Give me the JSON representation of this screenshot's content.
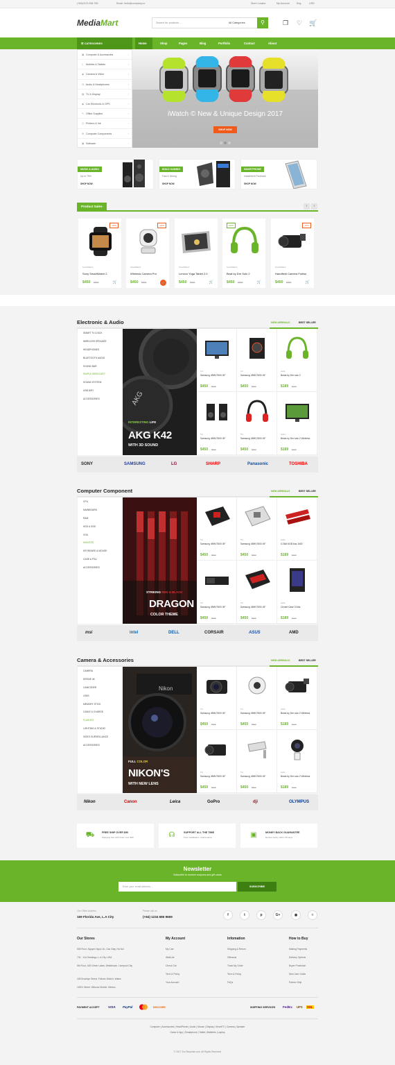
{
  "topbar": {
    "phone": "(+84)0123 456 789",
    "email": "Email: hello@company.co",
    "store_locator": "Store Locator",
    "my_account": "My Account",
    "language": "Eng",
    "currency": "USD"
  },
  "header": {
    "logo_main": "Media",
    "logo_accent": "Mart",
    "search_placeholder": "Search for products ...",
    "search_category": "All Categories"
  },
  "nav": {
    "categories_label": "CATEGORIES",
    "items": [
      "Home",
      "Shop",
      "Pages",
      "Blog",
      "Portfolio",
      "Contact",
      "About"
    ]
  },
  "categories": [
    "Computer & Accessories",
    "Mobiles & Tablets",
    "Camera & Video",
    "Audio & Headphones",
    "TV & Display",
    "Car Electronic & GPS",
    "Office Supplies",
    "Printers & Ink",
    "Computer Components",
    "Software"
  ],
  "hero": {
    "title": "iWatch © New & Unique Design 2017",
    "cta": "SHOP NOW"
  },
  "banners": [
    {
      "tag": "MUSIC & AUDIO",
      "sub": "Up to 75%",
      "link": "SHOP NOW"
    },
    {
      "tag": "BUILD GAMING",
      "sub": "Fast & Strong",
      "link": "SHOP NOW"
    },
    {
      "tag": "SMARTPHONE",
      "sub": "Installment Purchase",
      "link": "SHOP NOW"
    }
  ],
  "product_sales": {
    "title": "Product Sales",
    "items": [
      {
        "brand": "SmartWatch",
        "name": "Sony SmartWatch 2",
        "price": "$450",
        "old": "$500",
        "badge": "-20%"
      },
      {
        "brand": "SmartWatch",
        "name": "Wireless Camera Pro",
        "price": "$450",
        "old": "$500",
        "badge": "-20%"
      },
      {
        "brand": "SmartWatch",
        "name": "Lenovo Yoga Tablet 2.0",
        "price": "$450",
        "old": "$500",
        "badge": ""
      },
      {
        "brand": "SmartWatch",
        "name": "Beat by Dre Solo 2",
        "price": "$450",
        "old": "$500",
        "badge": "NEW"
      },
      {
        "brand": "SmartWatch",
        "name": "Handfield Camera Forliss",
        "price": "$450",
        "old": "$500",
        "badge": "-20%"
      }
    ]
  },
  "tabs": {
    "new": "NEW ARRIVALS",
    "best": "BEST SELLER"
  },
  "sections": [
    {
      "title": "Electronic & Audio",
      "list": [
        "SMART TV & BOX",
        "WIRELESS SPEAKER",
        "HEADPHONES",
        "BLUETOOTH AUDIO",
        "SOUND BAR",
        "SIMPLE WEEKCARY",
        "SOUND SYSTEM",
        "USB WIFI",
        "ACCESSORIES"
      ],
      "promo": {
        "l1a": "INTERESTING",
        "l1b": " LIFE",
        "l2": "AKG K42",
        "l3": "WITH 3D SOUND"
      },
      "products": [
        {
          "brand": "Tivi",
          "name": "Samsung 49MV7600 49\"",
          "price": "$450",
          "old": "$500"
        },
        {
          "brand": "Tivi",
          "name": "Samsung 49MV7600 49\"",
          "price": "$450",
          "old": "$500"
        },
        {
          "brand": "Audio",
          "name": "Beats by Dre solo 2",
          "price": "$189",
          "old": "$220"
        },
        {
          "brand": "Tivi",
          "name": "Samsung 49MV7600 49\"",
          "price": "$450",
          "old": "$500"
        },
        {
          "brand": "Tivi",
          "name": "Samsung 49MV7600 49\"",
          "price": "$450",
          "old": "$500"
        },
        {
          "brand": "Audio",
          "name": "Beats by Dre solo 2 Wireless",
          "price": "$189",
          "old": "$220"
        }
      ],
      "brands": [
        "SONY",
        "SAMSUNG",
        "LG",
        "SHARP",
        "Panasonic",
        "TOSHIBA"
      ]
    },
    {
      "title": "Computer Component",
      "list": [
        "CPU",
        "MAINBOARD",
        "RAM",
        "HDD & SSD",
        "VGA",
        "MONITER",
        "KEYBOARD & MOUSE",
        "CASE & PSU",
        "ACCESSORIES"
      ],
      "promo": {
        "l1a": "STRIKING",
        "l1b": " RED & BLACK",
        "l2": "DRAGON",
        "l3": "COLOR THEME"
      },
      "products": [
        {
          "brand": "Tivi",
          "name": "Samsung 49MV7600 49\"",
          "price": "$450",
          "old": "$500"
        },
        {
          "brand": "Tivi",
          "name": "Samsung 49MV7600 49\"",
          "price": "$450",
          "old": "$500"
        },
        {
          "brand": "Audio",
          "name": "G.Skill 4GB bus 1600",
          "price": "$189",
          "old": "$220"
        },
        {
          "brand": "Tivi",
          "name": "Samsung 49MV7600 49\"",
          "price": "$450",
          "old": "$500"
        },
        {
          "brand": "Tivi",
          "name": "Samsung 49MV7600 49\"",
          "price": "$450",
          "old": "$500"
        },
        {
          "brand": "Audio",
          "name": "Cricket Case 3 foils",
          "price": "$189",
          "old": "$220"
        }
      ],
      "brands": [
        "msi",
        "intel",
        "DELL",
        "CORSAIR",
        "ASUS",
        "AMD"
      ]
    },
    {
      "title": "Camera & Accessories",
      "list": [
        "CAMERA",
        "DRONE 4K",
        "CAMCODER",
        "LENS",
        "MEMORY STICK",
        "CABLE & CHARGE",
        "FLASHES",
        "LIGHTING & STUDIO",
        "VIDEO SURVEILLANCE",
        "ACCESSORIES"
      ],
      "promo": {
        "l1a": "FULL",
        "l1b": " COLOR",
        "l2": "NIKON'S",
        "l3": "WITH NEW LENS"
      },
      "products": [
        {
          "brand": "Tivi",
          "name": "Samsung 49MV7600 49\"",
          "price": "$450",
          "old": "$500"
        },
        {
          "brand": "Tivi",
          "name": "Samsung 49MV7600 49\"",
          "price": "$450",
          "old": "$500"
        },
        {
          "brand": "Audio",
          "name": "Beats by Dre solo 2 Wireless",
          "price": "$189",
          "old": "$220"
        },
        {
          "brand": "Tivi",
          "name": "Samsung 49MV7600 49\"",
          "price": "$450",
          "old": "$500"
        },
        {
          "brand": "Tivi",
          "name": "Samsung 49MV7600 49\"",
          "price": "$450",
          "old": "$500"
        },
        {
          "brand": "Audio",
          "name": "Beats by Dre solo 2 Wireless",
          "price": "$189",
          "old": "$220"
        }
      ],
      "brands": [
        "Nikon",
        "Canon",
        "Leica",
        "GoPro",
        "dji",
        "OLYMPUS"
      ]
    }
  ],
  "features": [
    {
      "title": "FREE SHIP OVER $90",
      "sub": "Shipping free with order over $90"
    },
    {
      "title": "SUPPORT ALL THE TIME",
      "sub": "Free installation, maintenance"
    },
    {
      "title": "MONEY BACK GUARANTEE",
      "sub": "Refund policy within 30 days"
    }
  ],
  "newsletter": {
    "title": "Newsletter",
    "sub": "Subscribe to receive coupons and gift cards",
    "placeholder": "Enter your email address...",
    "button": "SUBSCRIBE"
  },
  "footer": {
    "address_label": "Our Office Address",
    "address": "169 Florida Ave, L.A City",
    "call_label": "Please call us",
    "phone": "(+84) 1234 686 9669",
    "cols": [
      {
        "title": "Our Stores",
        "items": [
          "505 Floor, Nguyen Ngoc Vu, Cau Giay, Ha Noi",
          "741 - 11A Sandiago, L.A City, USA",
          "5th Floor, 169 Green Lakes, Westbrown, Liverpool City",
          "428 Brooklyn Street, Fulham District, Wales",
          "10001 Street, Wincow District, Mexico."
        ]
      },
      {
        "title": "My Account",
        "items": [
          "My Cart",
          "WishList",
          "Check Out",
          "Term & Policy",
          "Your Account"
        ]
      },
      {
        "title": "Infomation",
        "items": [
          "Shipping & Return",
          "Giftcards",
          "Track My Order",
          "Term & Policy",
          "FAQs"
        ]
      },
      {
        "title": "How to Buy",
        "items": [
          "Making Payments",
          "Delivery Options",
          "Buyer Protection",
          "New User Guide",
          "Partner Ship"
        ]
      }
    ],
    "payment_label": "PAYMENT ACCEPT",
    "payments": [
      "VISA",
      "PayPal",
      "MC",
      "DISCOVER"
    ],
    "shipping_label": "SHIPPING SERVICES",
    "shippers": [
      "FedEx",
      "UPS",
      "DHL"
    ],
    "links1": "Computer  |  Accessories  |  HeadPhone  |  Audio  |  Mouse  |  Display  |  SmartTV  |  Camera  |  Speaker",
    "links2": "Game & App  |  Smartphone  |  Tablet  |  Batteries  |  Laptop",
    "copyright": "© 2017 ZooTemplate.com. All Rights Reserved"
  }
}
